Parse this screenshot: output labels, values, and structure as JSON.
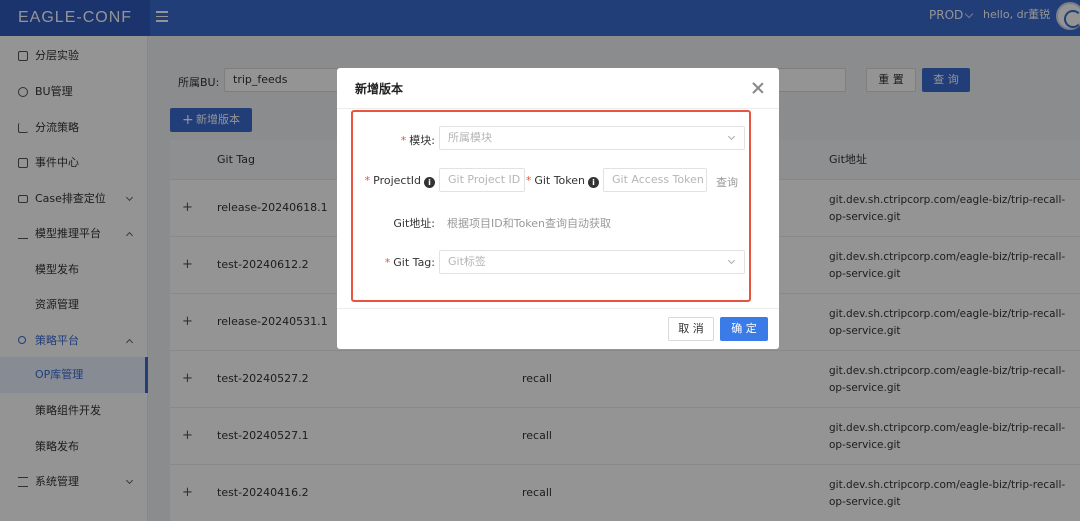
{
  "app": {
    "title": "EAGLE-CONF",
    "env": "PROD",
    "user_greeting": "hello, dr董锐"
  },
  "sidebar": {
    "items": [
      {
        "label": "分层实验",
        "icon": "layers-icon"
      },
      {
        "label": "BU管理",
        "icon": "globe-icon"
      },
      {
        "label": "分流策略",
        "icon": "branch-icon"
      },
      {
        "label": "事件中心",
        "icon": "calendar-icon"
      },
      {
        "label": "Case排查定位",
        "icon": "monitor-icon"
      },
      {
        "label": "模型推理平台",
        "icon": "model-icon"
      },
      {
        "label": "模型发布"
      },
      {
        "label": "资源管理"
      },
      {
        "label": "策略平台",
        "icon": "strategy-icon"
      },
      {
        "label": "OP库管理"
      },
      {
        "label": "策略组件开发"
      },
      {
        "label": "策略发布"
      },
      {
        "label": "系统管理",
        "icon": "list-icon"
      }
    ]
  },
  "filter": {
    "bu_label": "所属BU:",
    "bu_value": "trip_feeds",
    "reset_label": "重 置",
    "search_label": "查 询"
  },
  "toolbar": {
    "add_label": "新增版本"
  },
  "table": {
    "headers": [
      "Git Tag",
      "Git地址"
    ],
    "rows": [
      {
        "tag": "release-20240618.1",
        "module": "",
        "git": "git.dev.sh.ctripcorp.com/eagle-biz/trip-recall-op-service.git"
      },
      {
        "tag": "test-20240612.2",
        "module": "",
        "git": "git.dev.sh.ctripcorp.com/eagle-biz/trip-recall-op-service.git"
      },
      {
        "tag": "release-20240531.1",
        "module": "",
        "git": "git.dev.sh.ctripcorp.com/eagle-biz/trip-recall-op-service.git"
      },
      {
        "tag": "test-20240527.2",
        "module": "recall",
        "git": "git.dev.sh.ctripcorp.com/eagle-biz/trip-recall-op-service.git"
      },
      {
        "tag": "test-20240527.1",
        "module": "recall",
        "git": "git.dev.sh.ctripcorp.com/eagle-biz/trip-recall-op-service.git"
      },
      {
        "tag": "test-20240416.2",
        "module": "recall",
        "git": "git.dev.sh.ctripcorp.com/eagle-biz/trip-recall-op-service.git"
      }
    ]
  },
  "modal": {
    "title": "新增版本",
    "module_label": "模块:",
    "module_placeholder": "所属模块",
    "projectid_label": "ProjectId",
    "projectid_placeholder": "Git Project ID",
    "gittoken_label": "Git Token",
    "gittoken_placeholder": "Git Access Token",
    "query_label": "查询",
    "gitaddr_label": "Git地址:",
    "gitaddr_hint": "根据项目ID和Token查询自动获取",
    "gittag_label": "Git Tag:",
    "gittag_placeholder": "Git标签",
    "cancel_label": "取 消",
    "ok_label": "确 定"
  }
}
